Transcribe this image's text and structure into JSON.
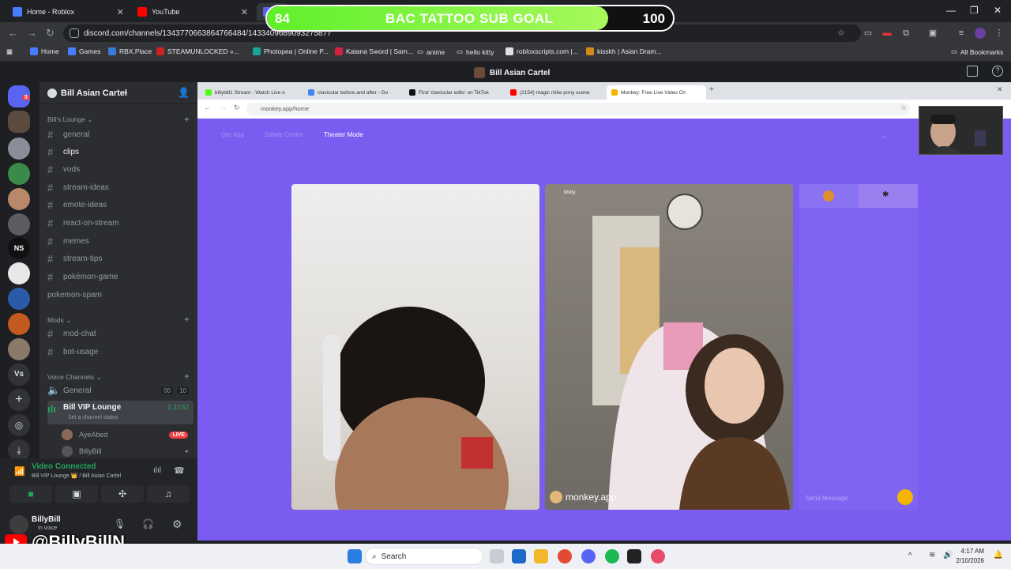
{
  "browser": {
    "tabs": [
      {
        "label": "Home - Roblox",
        "color": "#4a7cff"
      },
      {
        "label": "YouTube",
        "color": "#ff0000"
      }
    ],
    "url": "discord.com/channels/1343770663864766484/1433409689093275877",
    "bookmarks": [
      "Home",
      "Games",
      "RBX.Place",
      "STEAMUNLOCKED »...",
      "Photopea | Online P...",
      "Katana Sword | Sam...",
      "anime",
      "hello kitty",
      "robloxscripts.com |...",
      "kisskh | Asian Dram..."
    ],
    "all_bookmarks": "All Bookmarks"
  },
  "overlay": {
    "goal_start": "84",
    "goal_title": "BAC TATTOO SUB GOAL",
    "goal_end": "100",
    "goal_progress": 0.84,
    "youtube_handle": "@BillyBillN"
  },
  "discord": {
    "window_title": "Bill Asian Cartel",
    "server_name": "Bill Asian Cartel",
    "categories": {
      "lounge": "Bill's Lounge",
      "mods": "Mods",
      "voice": "Voice Channels"
    },
    "channels": [
      {
        "name": "general",
        "emoji": "💭"
      },
      {
        "name": "clips",
        "emoji": "📼"
      },
      {
        "name": "vods",
        "emoji": "📺"
      },
      {
        "name": "stream-ideas",
        "emoji": "💡"
      },
      {
        "name": "emote-ideas",
        "emoji": "🏆"
      },
      {
        "name": "react-on-stream",
        "emoji": "😲"
      },
      {
        "name": "memes",
        "emoji": "😜"
      },
      {
        "name": "stream-tips",
        "emoji": "📄"
      },
      {
        "name": "pokémon-game",
        "emoji": "👩"
      },
      {
        "name": "pokemon-spam",
        "emoji": ""
      }
    ],
    "mod_channels": [
      {
        "name": "mod-chat",
        "emoji": "💃"
      },
      {
        "name": "bot-usage",
        "emoji": "🤖"
      }
    ],
    "voice_channels": [
      {
        "name": "General",
        "c1": "00",
        "c2": "10"
      },
      {
        "name": "Bill VIP Lounge",
        "time": "1:32:52",
        "status": "Set a channel status"
      }
    ],
    "voice_users": [
      {
        "name": "AyeAbed",
        "badge": "LIVE"
      },
      {
        "name": "BillyBill"
      }
    ],
    "connection": {
      "status": "Video Connected",
      "location": "Bill VIP Lounge 👑 / Bill Asian Cartel"
    },
    "user": {
      "name": "BillyBill",
      "status": "In voice"
    },
    "guild_labels": [
      "NS",
      "Vs"
    ],
    "guild_badge": "5"
  },
  "inner_browser": {
    "tabs": [
      "billybill1 Stream - Watch Live o",
      "clavicular before and after - Go",
      "Find 'clavicular edits' on TikTok",
      "(2154) magic mike pony scene",
      "Monkey: Free Live Video Ch"
    ],
    "url": "monkey.app/home",
    "nav": {
      "get_app": "Get App",
      "safety": "Safety Center",
      "theater": "Theater Mode"
    },
    "watermark": "monkey.app",
    "chat_placeholder": "Send Message",
    "peer_name": "bhitty"
  },
  "taskbar": {
    "search": "Search",
    "time": "4:17 AM",
    "date": "2/10/2026"
  }
}
